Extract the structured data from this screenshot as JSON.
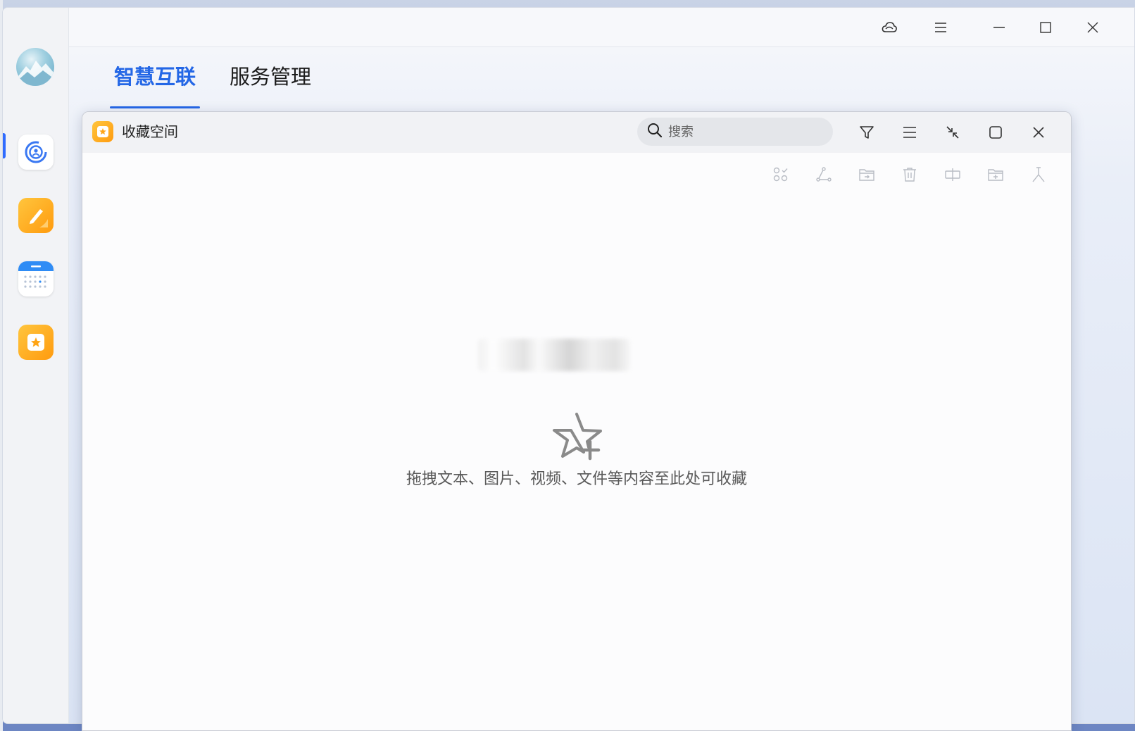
{
  "host": {
    "tabs": [
      {
        "label": "智慧互联",
        "active": true
      },
      {
        "label": "服务管理",
        "active": false
      }
    ],
    "titlebar_icons": [
      "cloud-icon",
      "menu-icon",
      "minimize-icon",
      "maximize-icon",
      "close-icon"
    ],
    "sidebar_apps": [
      "connect-app-icon",
      "notes-app-icon",
      "calendar-app-icon",
      "favorites-app-icon"
    ]
  },
  "fav_window": {
    "title": "收藏空间",
    "search": {
      "placeholder": "搜索",
      "value": ""
    },
    "header_icons": [
      "filter-icon",
      "list-icon",
      "collapse-icon",
      "maximize-icon",
      "close-icon"
    ],
    "toolbar_icons": [
      "select-icon",
      "share-icon",
      "move-to-folder-icon",
      "delete-icon",
      "merge-icon",
      "new-folder-icon",
      "pin-icon"
    ],
    "empty_state": {
      "message": "拖拽文本、图片、视频、文件等内容至此处可收藏",
      "icon": "star-add-icon"
    }
  },
  "colors": {
    "accent": "#2467e6",
    "app_orange": "#ffb020"
  }
}
